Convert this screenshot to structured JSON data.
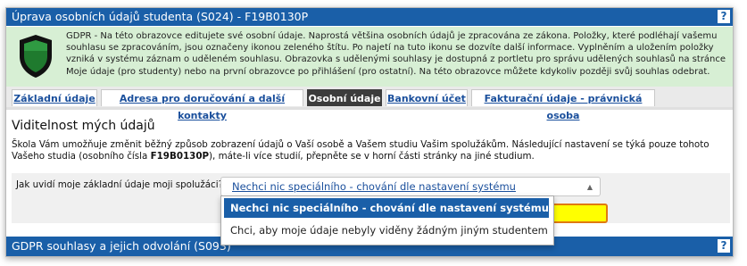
{
  "header": {
    "title": "Úprava osobních údajů studenta (S024) - F19B0130P",
    "help_label": "?"
  },
  "gdpr": {
    "text": "GDPR - Na této obrazovce editujete své osobní údaje. Naprostá většina osobních údajů je zpracována ze zákona. Položky, které podléhají vašemu souhlasu se zpracováním, jsou označeny ikonou zeleného štítu. Po najetí na tuto ikonu se dozvíte další informace. Vyplněním a uložením položky vzniká v systému záznam o uděleném souhlasu. Obrazovka s udělenými souhlasy je dostupná z portletu pro správu udělených souhlasů na stránce Moje údaje (pro studenty) nebo na první obrazovce po přihlášení (pro ostatní). Na této obrazovce můžete kdykoliv později svůj souhlas odebrat.",
    "shield_color": "#1f7a2e"
  },
  "tabs": [
    {
      "label": "Základní údaje",
      "active": false
    },
    {
      "label": "Adresa pro doručování a další kontakty",
      "active": false
    },
    {
      "label": "Osobní údaje",
      "active": true
    },
    {
      "label": "Bankovní účet",
      "active": false
    },
    {
      "label": "Fakturační údaje - právnická osoba",
      "active": false
    }
  ],
  "main": {
    "heading": "Viditelnost mých údajů",
    "description_part1": "Škola Vám umožňuje změnit běžný způsob zobrazení údajů o Vaší osobě a Vašem studiu Vašim spolužákům. Následující nastavení se týká pouze tohoto Vašeho studia (osobního čísla ",
    "description_bold": "F19B0130P",
    "description_part2": "), máte-li více studií, přepněte se v horní části stránky na jiné studium.",
    "question_label": "Jak uvidí moje základní údaje moji spolužáci?",
    "select_value": "Nechci nic speciálního - chování dle nastavení systému",
    "options": [
      "Nechci nic speciálního - chování dle nastavení systému",
      "Chci, aby moje údaje nebyly viděny žádným jiným studentem"
    ]
  },
  "footer": {
    "title": "GDPR souhlasy a jejich odvolání (S093)",
    "help_label": "?"
  },
  "colors": {
    "accent": "#1a5fa8",
    "gdpr_bg": "#d7efd4",
    "highlight": "#ffff00"
  }
}
